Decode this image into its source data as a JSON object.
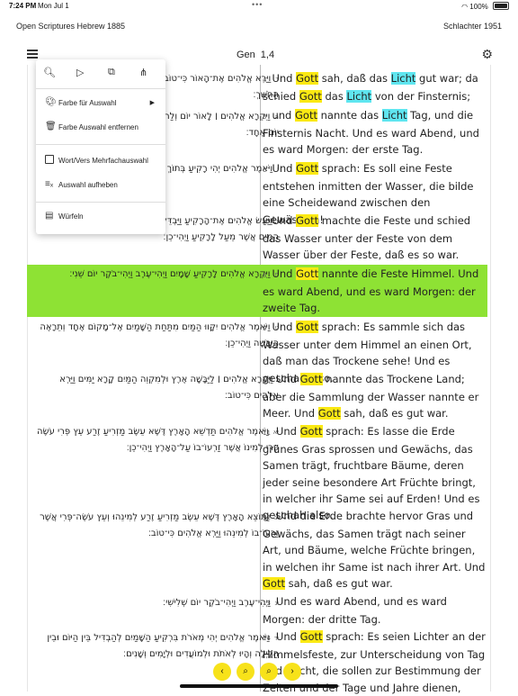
{
  "status": {
    "time": "7:24 PM",
    "date": "Mon Jul 1",
    "battery": "100%",
    "dots": "•••"
  },
  "versions": {
    "left": "Open Scriptures Hebrew 1885",
    "right": "Schlachter 1951"
  },
  "toolbar": {
    "book": "Gen",
    "chapter": "1,4",
    "gear_icon": "gear-icon",
    "menu_icon": "hamburger-icon"
  },
  "popup": {
    "icons": [
      "search-icon",
      "play-icon",
      "copy-icon",
      "share-icon"
    ],
    "items": [
      {
        "icon": "palette-icon",
        "label": "Farbe für Auswahl",
        "arrow": "▶"
      },
      {
        "icon": "trash-icon",
        "label": "Farbe Auswahl entfernen"
      },
      {
        "icon": "checkbox-icon",
        "label": "Wort/Vers Mehrfachauswahl"
      },
      {
        "icon": "clear-selection-icon",
        "label": "Auswahl aufheben"
      },
      {
        "icon": "shuffle-icon",
        "label": "Würfeln"
      }
    ]
  },
  "verses": [
    {
      "n": "4",
      "heb_n": "ד",
      "heb": "וַיַּרְא אֱלֹהִים אֶת־הָאוֹר כִּי־טוֹב וַיַּבְדֵּל אֱלֹהִים בֵּין הָאוֹר וּבֵין הַחֹשֶׁךְ׃",
      "ger": [
        [
          "Und "
        ],
        [
          "Gott",
          "y"
        ],
        [
          " sah, daß das "
        ],
        [
          "Licht",
          "c"
        ],
        [
          " gut war; da schied "
        ],
        [
          "Gott",
          "y"
        ],
        [
          " das "
        ],
        [
          "Licht",
          "c"
        ],
        [
          " von der Finsternis;"
        ]
      ]
    },
    {
      "n": "5",
      "heb_n": "ה",
      "heb": "וַיִּקְרָא אֱלֹהִים ׀ לָאוֹר יוֹם וְלַחֹשֶׁךְ קָרָא לָיְלָה וַיְהִי־עֶרֶב וַיְהִי־בֹקֶר יוֹם אֶחָד׃",
      "ger": [
        [
          "und "
        ],
        [
          "Gott",
          "y"
        ],
        [
          " nannte das "
        ],
        [
          "Licht",
          "c"
        ],
        [
          " Tag, und die Finsternis Nacht. Und es ward Abend, und es ward Morgen: der erste Tag."
        ]
      ]
    },
    {
      "n": "6",
      "heb_n": "ו",
      "heb": "וַיֹּאמֶר אֱלֹהִים יְהִי רָקִיעַ בְּתוֹךְ הַמָּיִם וִיהִי מַבְדִּיל בֵּין מַיִם לָמָיִם׃",
      "ger": [
        [
          "Und "
        ],
        [
          "Gott",
          "y"
        ],
        [
          " sprach: Es soll eine Feste entstehen inmitten der Wasser, die bilde eine Scheidewand zwischen den Gewässern!"
        ]
      ]
    },
    {
      "n": "7",
      "heb_n": "ז",
      "heb": "וַיַּעַשׂ אֱלֹהִים אֶת־הָרָקִיעַ וַיַּבְדֵּל בֵּין הַמַּיִם אֲשֶׁר מִתַּחַת לָרָקִיעַ וּבֵין הַמַּיִם אֲשֶׁר מֵעַל לָרָקִיעַ וַיְהִי־כֵן׃",
      "ger": [
        [
          "Und "
        ],
        [
          "Gott",
          "y"
        ],
        [
          " machte die Feste und schied das Wasser unter der Feste von dem Wasser über der Feste, daß es so war."
        ]
      ]
    },
    {
      "n": "8",
      "heb_n": "ח",
      "heb": "וַיִּקְרָא אֱלֹהִים לָרָקִיעַ שָׁמָיִם וַיְהִי־עֶרֶב וַיְהִי־בֹקֶר יוֹם שֵׁנִי׃",
      "ger": [
        [
          "Und "
        ],
        [
          "Gott",
          "y"
        ],
        [
          " nannte die Feste Himmel. Und es ward Abend, und es ward Morgen: der zweite Tag."
        ]
      ]
    },
    {
      "n": "9",
      "heb_n": "ט",
      "heb": "וַיֹּאמֶר אֱלֹהִים יִקָּווּ הַמַּיִם מִתַּחַת הַשָּׁמַיִם אֶל־מָקוֹם אֶחָד וְתֵרָאֶה הַיַּבָּשָׁה וַיְהִי־כֵן׃",
      "ger": [
        [
          "Und "
        ],
        [
          "Gott",
          "y"
        ],
        [
          " sprach: Es sammle sich das Wasser unter dem Himmel an einen Ort, daß man das Trockene sehe! Und es geschah also."
        ]
      ]
    },
    {
      "n": "10",
      "heb_n": "י",
      "heb": "וַיִּקְרָא אֱלֹהִים ׀ לַיַּבָּשָׁה אֶרֶץ וּלְמִקְוֵה הַמַּיִם קָרָא יַמִּים וַיַּרְא אֱלֹהִים כִּי־טוֹב׃",
      "ger": [
        [
          "Und "
        ],
        [
          "Gott",
          "y"
        ],
        [
          " nannte das Trockene Land; aber die Sammlung der Wasser nannte er Meer. Und "
        ],
        [
          "Gott",
          "y"
        ],
        [
          " sah, daß es gut war."
        ]
      ]
    },
    {
      "n": "11",
      "heb_n": "יא",
      "heb": "וַיֹּאמֶר אֱלֹהִים תַּדְשֵׁא הָאָרֶץ דֶּשֶׁא עֵשֶׂב מַזְרִיעַ זֶרַע עֵץ פְּרִי עֹשֶׂה פְּרִי לְמִינוֹ אֲשֶׁר זַרְעוֹ־בוֹ עַל־הָאָרֶץ וַיְהִי־כֵן׃",
      "ger": [
        [
          "Und "
        ],
        [
          "Gott",
          "y"
        ],
        [
          " sprach: Es lasse die Erde grünes Gras sprossen und Gewächs, das Samen trägt, fruchtbare Bäume, deren jeder seine besondere Art Früchte bringt, in welcher ihr Same sei auf Erden! Und es geschah also."
        ]
      ]
    },
    {
      "n": "12",
      "heb_n": "יב",
      "heb": "וַתּוֹצֵא הָאָרֶץ דֶּשֶׁא עֵשֶׂב מַזְרִיעַ זֶרַע לְמִינֵהוּ וְעֵץ עֹשֶׂה־פְּרִי אֲשֶׁר זַרְעוֹ־בוֹ לְמִינֵהוּ וַיַּרְא אֱלֹהִים כִּי־טוֹב׃",
      "ger": [
        [
          "Und die Erde brachte hervor Gras und Gewächs, das Samen trägt nach seiner Art, und Bäume, welche Früchte bringen, in welchen ihr Same ist nach ihrer Art. Und "
        ],
        [
          "Gott",
          "y"
        ],
        [
          " sah, daß es gut war."
        ]
      ]
    },
    {
      "n": "13",
      "heb_n": "יג",
      "heb": "וַיְהִי־עֶרֶב וַיְהִי־בֹקֶר יוֹם שְׁלִישִׁי׃",
      "ger": [
        [
          "Und es ward Abend, und es ward Morgen: der dritte Tag."
        ]
      ]
    },
    {
      "n": "14",
      "heb_n": "יד",
      "heb": "וַיֹּאמֶר אֱלֹהִים יְהִי מְאֹרֹת בִּרְקִיעַ הַשָּׁמַיִם לְהַבְדִּיל בֵּין הַיּוֹם וּבֵין הַלָּיְלָה וְהָיוּ לְאֹתֹת וּלְמוֹעֲדִים וּלְיָמִים וְשָׁנִים׃",
      "ger": [
        [
          "Und "
        ],
        [
          "Gott",
          "y"
        ],
        [
          " sprach: Es seien Lichter an der Himmelsfeste, zur Unterscheidung von Tag und Nacht, die sollen zur Bestimmung der Zeiten und der Tage und Jahre dienen,"
        ]
      ]
    }
  ],
  "nav": {
    "prev": "‹",
    "search": "⌕",
    "search2": "⌕",
    "next": "›"
  }
}
